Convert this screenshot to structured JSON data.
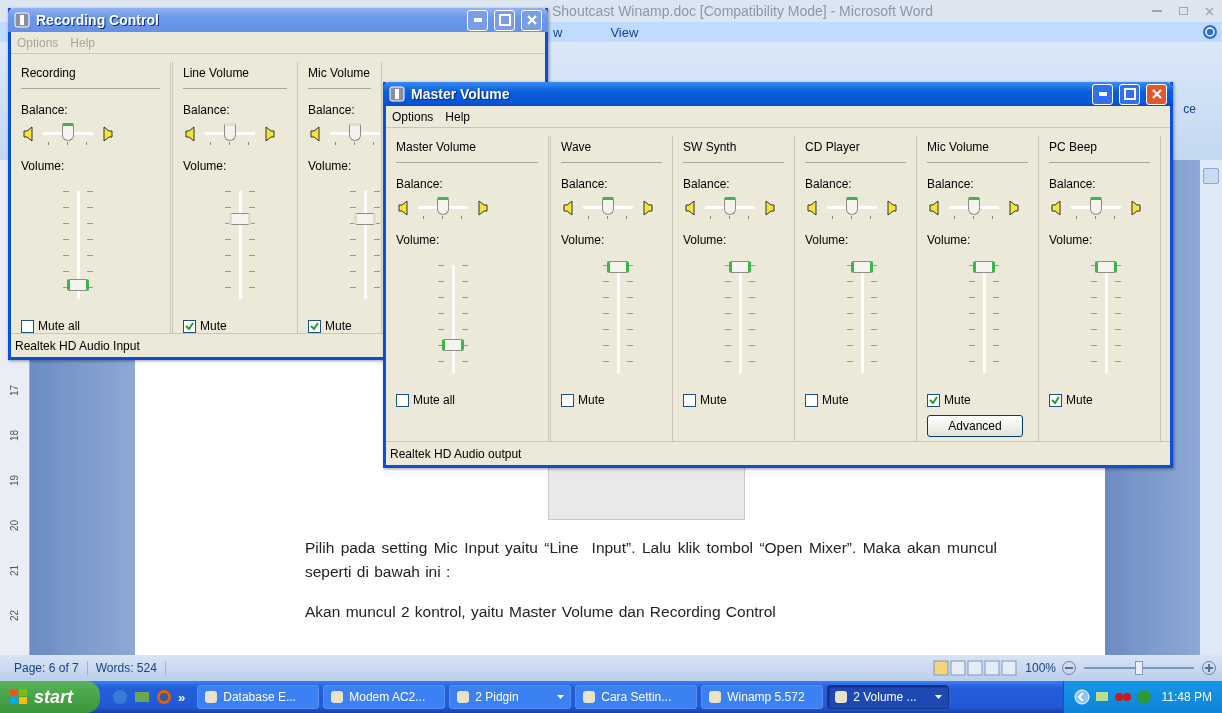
{
  "word": {
    "title": "Shoutcast Winamp.doc [Compatibility Mode] - Microsoft Word",
    "tabs": [
      "w",
      "View"
    ],
    "ribbon_fragment": "ce",
    "ruler": [
      "17",
      "18",
      "19",
      "20",
      "21",
      "22"
    ],
    "paragraphs": [
      "Pilih pada setting Mic Input yaitu “Line  Input”. Lalu klik tombol “Open Mixer”. Maka akan muncul seperti di bawah ini :",
      "Akan muncul 2 kontrol, yaitu Master Volume dan Recording Control"
    ],
    "status": {
      "page": "Page: 6 of 7",
      "words": "Words: 524",
      "zoom": "100%",
      "zoom_slider": {
        "level": 0.5
      }
    }
  },
  "recording": {
    "title": "Recording Control",
    "active": false,
    "menu": [
      "Options",
      "Help"
    ],
    "status": "Realtek HD Audio Input",
    "channels": [
      {
        "name": "Recording",
        "balance_label": "Balance:",
        "balance": {
          "level": 0.5
        },
        "volume_label": "Volume:",
        "volume": {
          "level": 0.12
        },
        "mute_label": "Mute all",
        "muted": false,
        "dimmed": false
      },
      {
        "name": "Line Volume",
        "balance_label": "Balance:",
        "balance": {
          "level": 0.5
        },
        "volume_label": "Volume:",
        "volume": {
          "level": 0.75
        },
        "mute_label": "Mute",
        "muted": true,
        "dimmed": true
      },
      {
        "name": "Mic Volume",
        "balance_label": "Balance:",
        "balance": {
          "level": 0.5
        },
        "volume_label": "Volume:",
        "volume": {
          "level": 0.75
        },
        "mute_label": "Mute",
        "muted": true,
        "dimmed": true
      }
    ]
  },
  "master": {
    "title": "Master Volume",
    "active": true,
    "menu": [
      "Options",
      "Help"
    ],
    "status": "Realtek HD Audio output",
    "channels": [
      {
        "name": "Master Volume",
        "balance_label": "Balance:",
        "balance": {
          "level": 0.5
        },
        "volume_label": "Volume:",
        "volume": {
          "level": 0.25
        },
        "mute_label": "Mute all",
        "muted": false,
        "dimmed": false
      },
      {
        "name": "Wave",
        "balance_label": "Balance:",
        "balance": {
          "level": 0.5
        },
        "volume_label": "Volume:",
        "volume": {
          "level": 1
        },
        "mute_label": "Mute",
        "muted": false,
        "dimmed": false
      },
      {
        "name": "SW Synth",
        "balance_label": "Balance:",
        "balance": {
          "level": 0.5
        },
        "volume_label": "Volume:",
        "volume": {
          "level": 1
        },
        "mute_label": "Mute",
        "muted": false,
        "dimmed": false
      },
      {
        "name": "CD Player",
        "balance_label": "Balance:",
        "balance": {
          "level": 0.5
        },
        "volume_label": "Volume:",
        "volume": {
          "level": 1
        },
        "mute_label": "Mute",
        "muted": false,
        "dimmed": false
      },
      {
        "name": "Mic Volume",
        "balance_label": "Balance:",
        "balance": {
          "level": 0.5
        },
        "volume_label": "Volume:",
        "volume": {
          "level": 1
        },
        "mute_label": "Mute",
        "muted": true,
        "dimmed": false,
        "button": "Advanced"
      },
      {
        "name": "PC Beep",
        "balance_label": "Balance:",
        "balance": {
          "level": 0.5
        },
        "volume_label": "Volume:",
        "volume": {
          "level": 1
        },
        "mute_label": "Mute",
        "muted": true,
        "dimmed": false
      }
    ]
  },
  "taskbar": {
    "start": "start",
    "more": "»",
    "buttons": [
      {
        "label": "Database E...",
        "selected": false,
        "grouped": false
      },
      {
        "label": "Modem AC2...",
        "selected": false,
        "grouped": false
      },
      {
        "label": "2 Pidgin",
        "selected": false,
        "grouped": true
      },
      {
        "label": "Cara Settin...",
        "selected": false,
        "grouped": false
      },
      {
        "label": "Winamp 5.572",
        "selected": false,
        "grouped": false
      },
      {
        "label": "2 Volume ...",
        "selected": true,
        "grouped": true
      }
    ],
    "clock": "11:48 PM"
  }
}
